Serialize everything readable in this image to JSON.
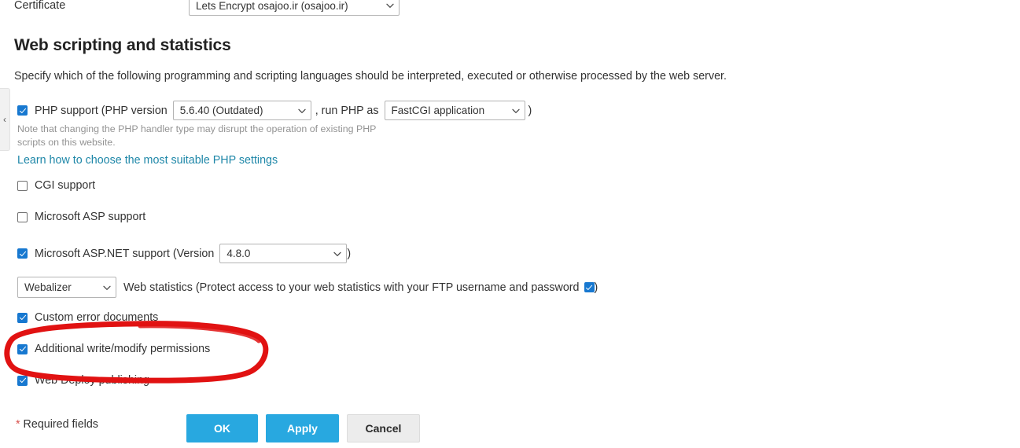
{
  "sidebar": {
    "collapse_icon": "chevron-left-icon"
  },
  "certificate": {
    "label": "Certificate",
    "selected": "Lets Encrypt osajoo.ir (osajoo.ir)",
    "caret_icon": "chevron-down-icon"
  },
  "section": {
    "heading": "Web scripting and statistics",
    "intro": "Specify which of the following programming and scripting languages should be interpreted, executed or otherwise processed by the web server."
  },
  "php": {
    "checked": true,
    "label_before": "PHP support (PHP version",
    "version_selected": "5.6.40 (Outdated)",
    "label_middle": ", run PHP as",
    "handler_selected": "FastCGI application",
    "label_after": ")",
    "note": "Note that changing the PHP handler type may disrupt the operation of existing PHP scripts on this website.",
    "link": "Learn how to choose the most suitable PHP settings"
  },
  "cgi": {
    "checked": false,
    "label": "CGI support"
  },
  "asp": {
    "checked": false,
    "label": "Microsoft ASP support"
  },
  "aspnet": {
    "checked": true,
    "label_before": "Microsoft ASP.NET support (Version",
    "version_selected": "4.8.0",
    "label_after": ")"
  },
  "webstats": {
    "engine_selected": "Webalizer",
    "label_before": "Web statistics (Protect access to your web statistics with your FTP username and password",
    "protect_checked": true,
    "label_after": ")"
  },
  "custom_error_documents": {
    "checked": true,
    "label": "Custom error documents"
  },
  "additional_permissions": {
    "checked": true,
    "label": "Additional write/modify permissions",
    "highlighted": true
  },
  "web_deploy": {
    "checked": true,
    "label": "Web Deploy publishing"
  },
  "footer": {
    "required_star": "*",
    "required_text": " Required fields",
    "ok_label": "OK",
    "apply_label": "Apply",
    "cancel_label": "Cancel"
  },
  "colors": {
    "primary_button": "#28a8e0",
    "checkbox_checked": "#1778d0",
    "link": "#1e87a8",
    "note_text": "#939393",
    "required_star": "#d9534f",
    "annotation_red": "#e11212"
  }
}
